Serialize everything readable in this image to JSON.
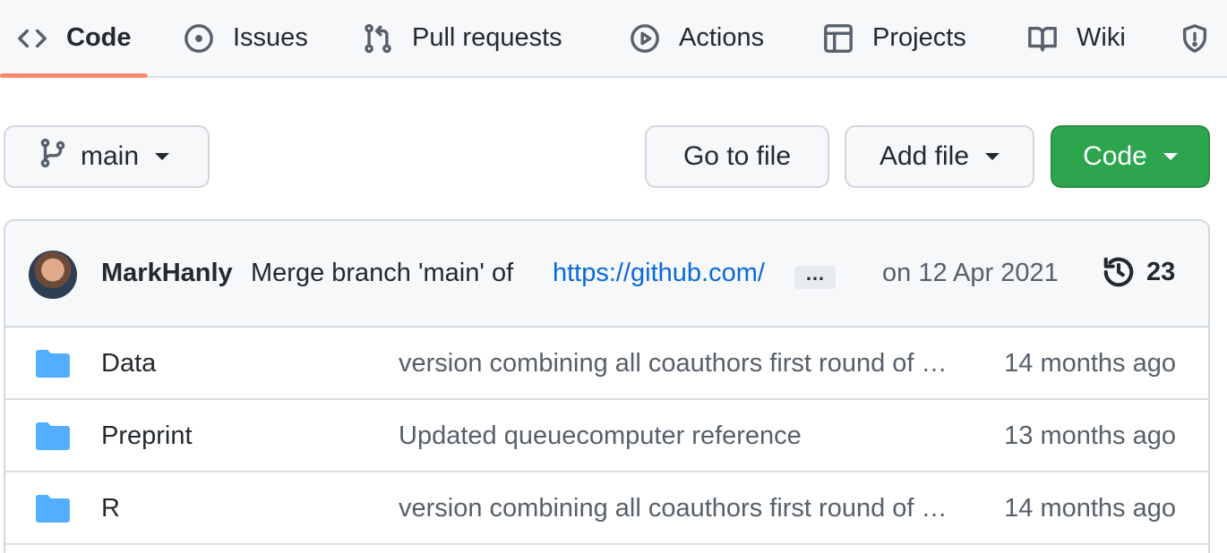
{
  "nav": {
    "tabs": [
      {
        "label": "Code",
        "icon": "code-icon",
        "active": true
      },
      {
        "label": "Issues",
        "icon": "issue-icon"
      },
      {
        "label": "Pull requests",
        "icon": "pull-request-icon"
      },
      {
        "label": "Actions",
        "icon": "play-icon"
      },
      {
        "label": "Projects",
        "icon": "table-icon"
      },
      {
        "label": "Wiki",
        "icon": "book-icon"
      },
      {
        "label": "",
        "icon": "shield-icon"
      }
    ],
    "active_color": "#fd8c73"
  },
  "toolbar": {
    "branch": "main",
    "goto_label": "Go to file",
    "addfile_label": "Add file",
    "code_label": "Code",
    "code_color": "#2da44e"
  },
  "commit": {
    "author": "MarkHanly",
    "message": "Merge branch 'main' of",
    "link": "https://github.com/",
    "date": "on 12 Apr 2021",
    "count": "23",
    "ellipsis": "…"
  },
  "files": [
    {
      "name": "Data",
      "message": "version combining all coauthors first round of comments",
      "age": "14 months ago",
      "type": "folder"
    },
    {
      "name": "Preprint",
      "message": "Updated queuecomputer reference",
      "age": "13 months ago",
      "type": "folder"
    },
    {
      "name": "R",
      "message": "version combining all coauthors first round of comments",
      "age": "14 months ago",
      "type": "folder"
    }
  ],
  "colors": {
    "folder": "#54aeff",
    "link": "#0969da"
  }
}
